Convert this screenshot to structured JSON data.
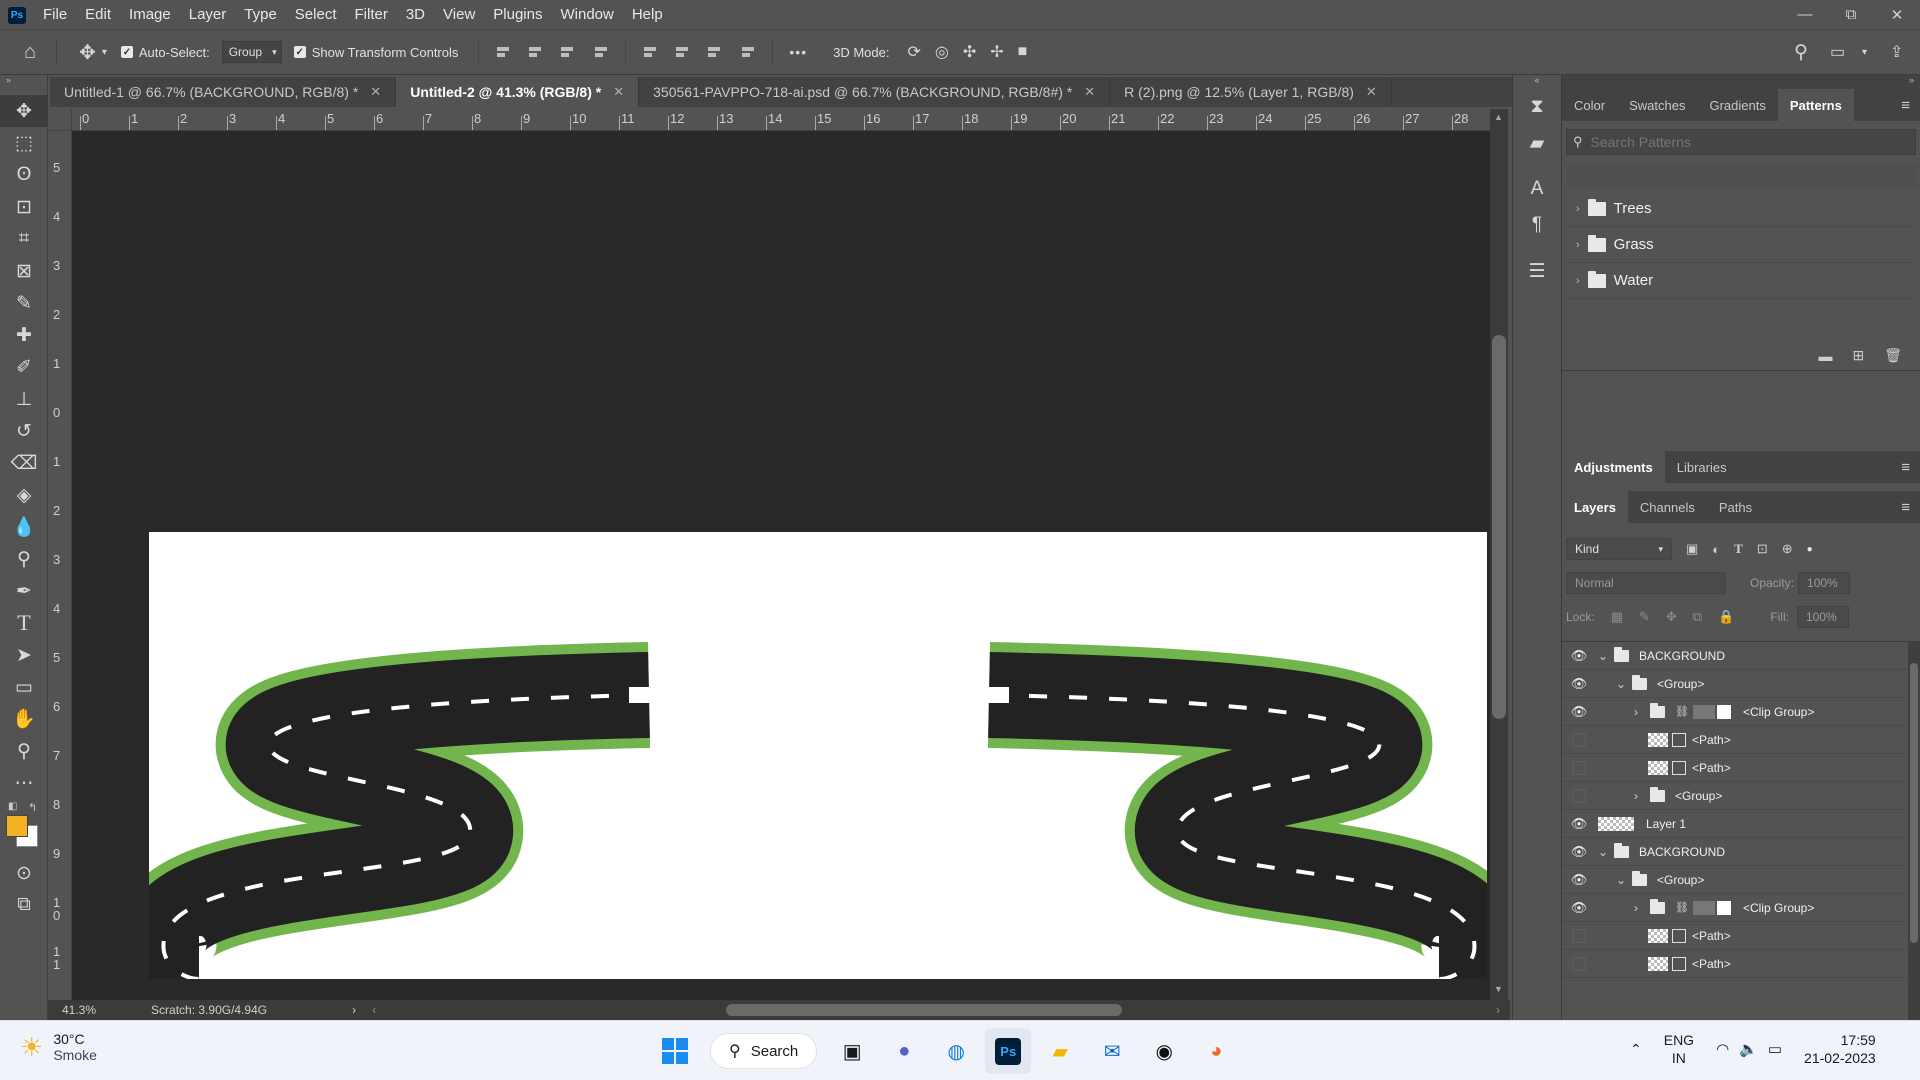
{
  "app": {
    "logo": "Ps"
  },
  "menu": [
    "File",
    "Edit",
    "Image",
    "Layer",
    "Type",
    "Select",
    "Filter",
    "3D",
    "View",
    "Plugins",
    "Window",
    "Help"
  ],
  "window_controls": {
    "minimize": "—",
    "restore": "⧉",
    "close": "✕"
  },
  "options": {
    "auto_select_label": "Auto-Select:",
    "auto_select_checked": true,
    "auto_select_value": "Group",
    "show_transform_label": "Show Transform Controls",
    "show_transform_checked": true,
    "more": "•••",
    "mode_3d_label": "3D Mode:"
  },
  "tabs": [
    {
      "label": "Untitled-1 @ 66.7% (BACKGROUND, RGB/8) *",
      "active": false
    },
    {
      "label": "Untitled-2 @ 41.3% (RGB/8) *",
      "active": true
    },
    {
      "label": "350561-PAVPPO-718-ai.psd @ 66.7% (BACKGROUND, RGB/8#) *",
      "active": false
    },
    {
      "label": "R (2).png @ 12.5% (Layer 1, RGB/8)",
      "active": false
    }
  ],
  "ruler_top": [
    "0",
    "1",
    "2",
    "3",
    "4",
    "5",
    "6",
    "7",
    "8",
    "9",
    "10",
    "11",
    "12",
    "13",
    "14",
    "15",
    "16",
    "17",
    "18",
    "19",
    "20",
    "21",
    "22",
    "23",
    "24",
    "25",
    "26",
    "27",
    "28"
  ],
  "ruler_left": [
    "5",
    "4",
    "3",
    "2",
    "1",
    "0",
    "1",
    "2",
    "3",
    "4",
    "5",
    "6",
    "7",
    "8",
    "9",
    "1\n0",
    "1\n1"
  ],
  "status": {
    "zoom": "41.3%",
    "scratch": "Scratch: 3.90G/4.94G",
    "arrow": "›"
  },
  "colors": {
    "foreground": "#f5b324",
    "background": "#ffffff",
    "road": "#222222",
    "road_edge": "#73b54d"
  },
  "patterns_panel": {
    "tabs": [
      {
        "label": "Color",
        "active": false
      },
      {
        "label": "Swatches",
        "active": false
      },
      {
        "label": "Gradients",
        "active": false
      },
      {
        "label": "Patterns",
        "active": true
      }
    ],
    "search_placeholder": "Search Patterns",
    "groups": [
      "Trees",
      "Grass",
      "Water"
    ]
  },
  "adjust_panel": {
    "tabs": [
      {
        "label": "Adjustments",
        "active": true
      },
      {
        "label": "Libraries",
        "active": false
      }
    ]
  },
  "layers_panel": {
    "tabs": [
      {
        "label": "Layers",
        "active": true
      },
      {
        "label": "Channels",
        "active": false
      },
      {
        "label": "Paths",
        "active": false
      }
    ],
    "kind_label": "Kind",
    "blend_mode": "Normal",
    "opacity_label": "Opacity:",
    "opacity_value": "100%",
    "lock_label": "Lock:",
    "fill_label": "Fill:",
    "fill_value": "100%",
    "layers": [
      {
        "name": "BACKGROUND",
        "type": "group",
        "visible": true,
        "expanded": true,
        "indent": 0
      },
      {
        "name": "<Group>",
        "type": "group",
        "visible": true,
        "expanded": true,
        "indent": 1
      },
      {
        "name": "<Clip Group>",
        "type": "clip",
        "visible": true,
        "expanded": false,
        "indent": 2
      },
      {
        "name": "<Path>",
        "type": "path",
        "visible": false,
        "indent": 2
      },
      {
        "name": "<Path>",
        "type": "path",
        "visible": false,
        "indent": 2
      },
      {
        "name": "<Group>",
        "type": "group",
        "visible": false,
        "expanded": false,
        "indent": 2
      },
      {
        "name": "Layer 1",
        "type": "layer",
        "visible": true,
        "indent": 0
      },
      {
        "name": "BACKGROUND",
        "type": "group",
        "visible": true,
        "expanded": true,
        "indent": 0
      },
      {
        "name": "<Group>",
        "type": "group",
        "visible": true,
        "expanded": true,
        "indent": 1
      },
      {
        "name": "<Clip Group>",
        "type": "clip",
        "visible": true,
        "expanded": false,
        "indent": 2
      },
      {
        "name": "<Path>",
        "type": "path",
        "visible": false,
        "indent": 2
      },
      {
        "name": "<Path>",
        "type": "path",
        "visible": false,
        "indent": 2
      }
    ]
  },
  "taskbar": {
    "temp": "30°C",
    "weather": "Smoke",
    "search_label": "Search",
    "lang1": "ENG",
    "lang2": "IN",
    "time": "17:59",
    "date": "21-02-2023"
  }
}
